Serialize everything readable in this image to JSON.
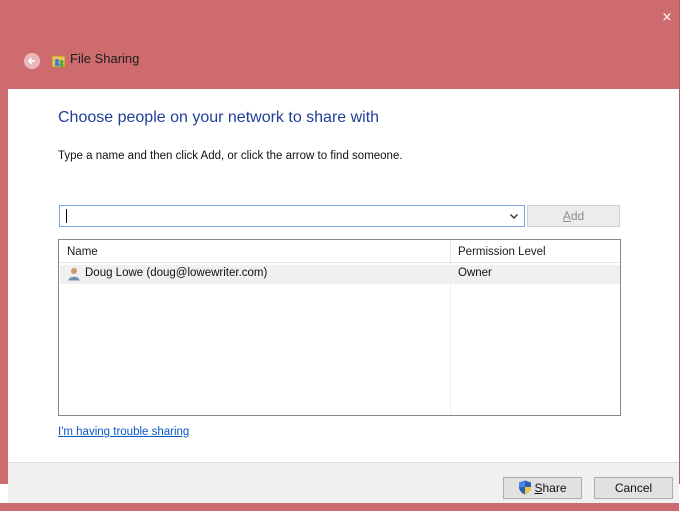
{
  "window": {
    "title": "File Sharing",
    "close_label": "×"
  },
  "content": {
    "heading": "Choose people on your network to share with",
    "instruction": "Type a name and then click Add, or click the arrow to find someone.",
    "name_input_value": "",
    "add_button": {
      "prefix": "",
      "accel": "A",
      "suffix": "dd"
    }
  },
  "list": {
    "columns": [
      "Name",
      "Permission Level"
    ],
    "rows": [
      {
        "name": "Doug Lowe (doug@lowewriter.com)",
        "permission": "Owner"
      }
    ]
  },
  "trouble_link": "I'm having trouble sharing",
  "buttons": {
    "share": {
      "prefix": "",
      "accel": "S",
      "suffix": "hare"
    },
    "cancel": "Cancel"
  },
  "colors": {
    "frame": "#cd6b6e",
    "heading": "#1f3f9a",
    "link": "#0a58c6"
  },
  "icons": {
    "back": "back-arrow-icon",
    "title": "file-sharing-icon",
    "user": "user-icon",
    "shield": "uac-shield-icon"
  }
}
